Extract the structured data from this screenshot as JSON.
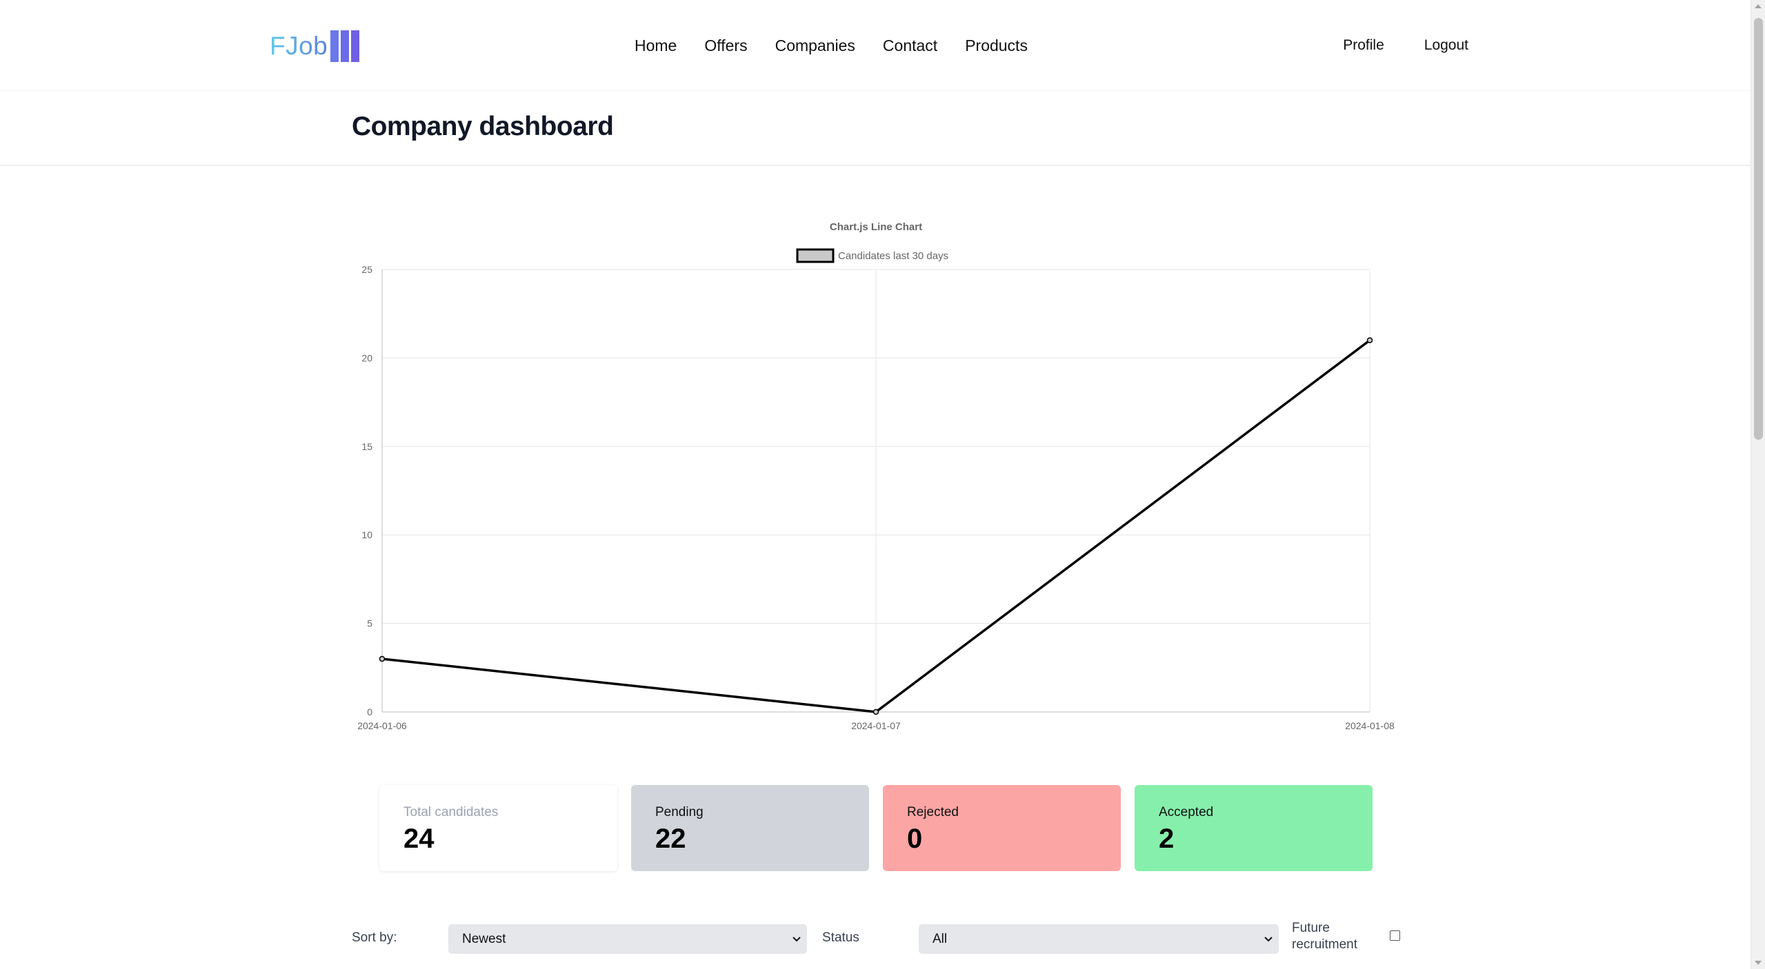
{
  "logo": {
    "text": "FJob"
  },
  "nav": {
    "links": [
      "Home",
      "Offers",
      "Companies",
      "Contact",
      "Products"
    ],
    "right": [
      "Profile",
      "Logout"
    ]
  },
  "page": {
    "title": "Company dashboard"
  },
  "chart_data": {
    "type": "line",
    "title": "Chart.js Line Chart",
    "categories": [
      "2024-01-06",
      "2024-01-07",
      "2024-01-08"
    ],
    "series": [
      {
        "name": "Candidates last 30 days",
        "values": [
          3,
          0,
          21
        ],
        "color": "#000000"
      }
    ],
    "ylim": [
      0,
      25
    ],
    "yticks": [
      0,
      5,
      10,
      15,
      20,
      25
    ],
    "grid": true,
    "legend": "top",
    "xlabel": "",
    "ylabel": ""
  },
  "stats": {
    "total": {
      "label": "Total candidates",
      "value": "24"
    },
    "pending": {
      "label": "Pending",
      "value": "22"
    },
    "rejected": {
      "label": "Rejected",
      "value": "0"
    },
    "accepted": {
      "label": "Accepted",
      "value": "2"
    }
  },
  "filters": {
    "sort_label": "Sort by:",
    "sort_value": "Newest",
    "status_label": "Status",
    "status_value": "All",
    "future_line1": "Future",
    "future_line2": "recruitment",
    "future_checked": false
  },
  "colors": {
    "pending": "#d1d5db",
    "rejected": "#fca5a5",
    "accepted": "#86efac",
    "logo_bars": "#6b63e6"
  }
}
